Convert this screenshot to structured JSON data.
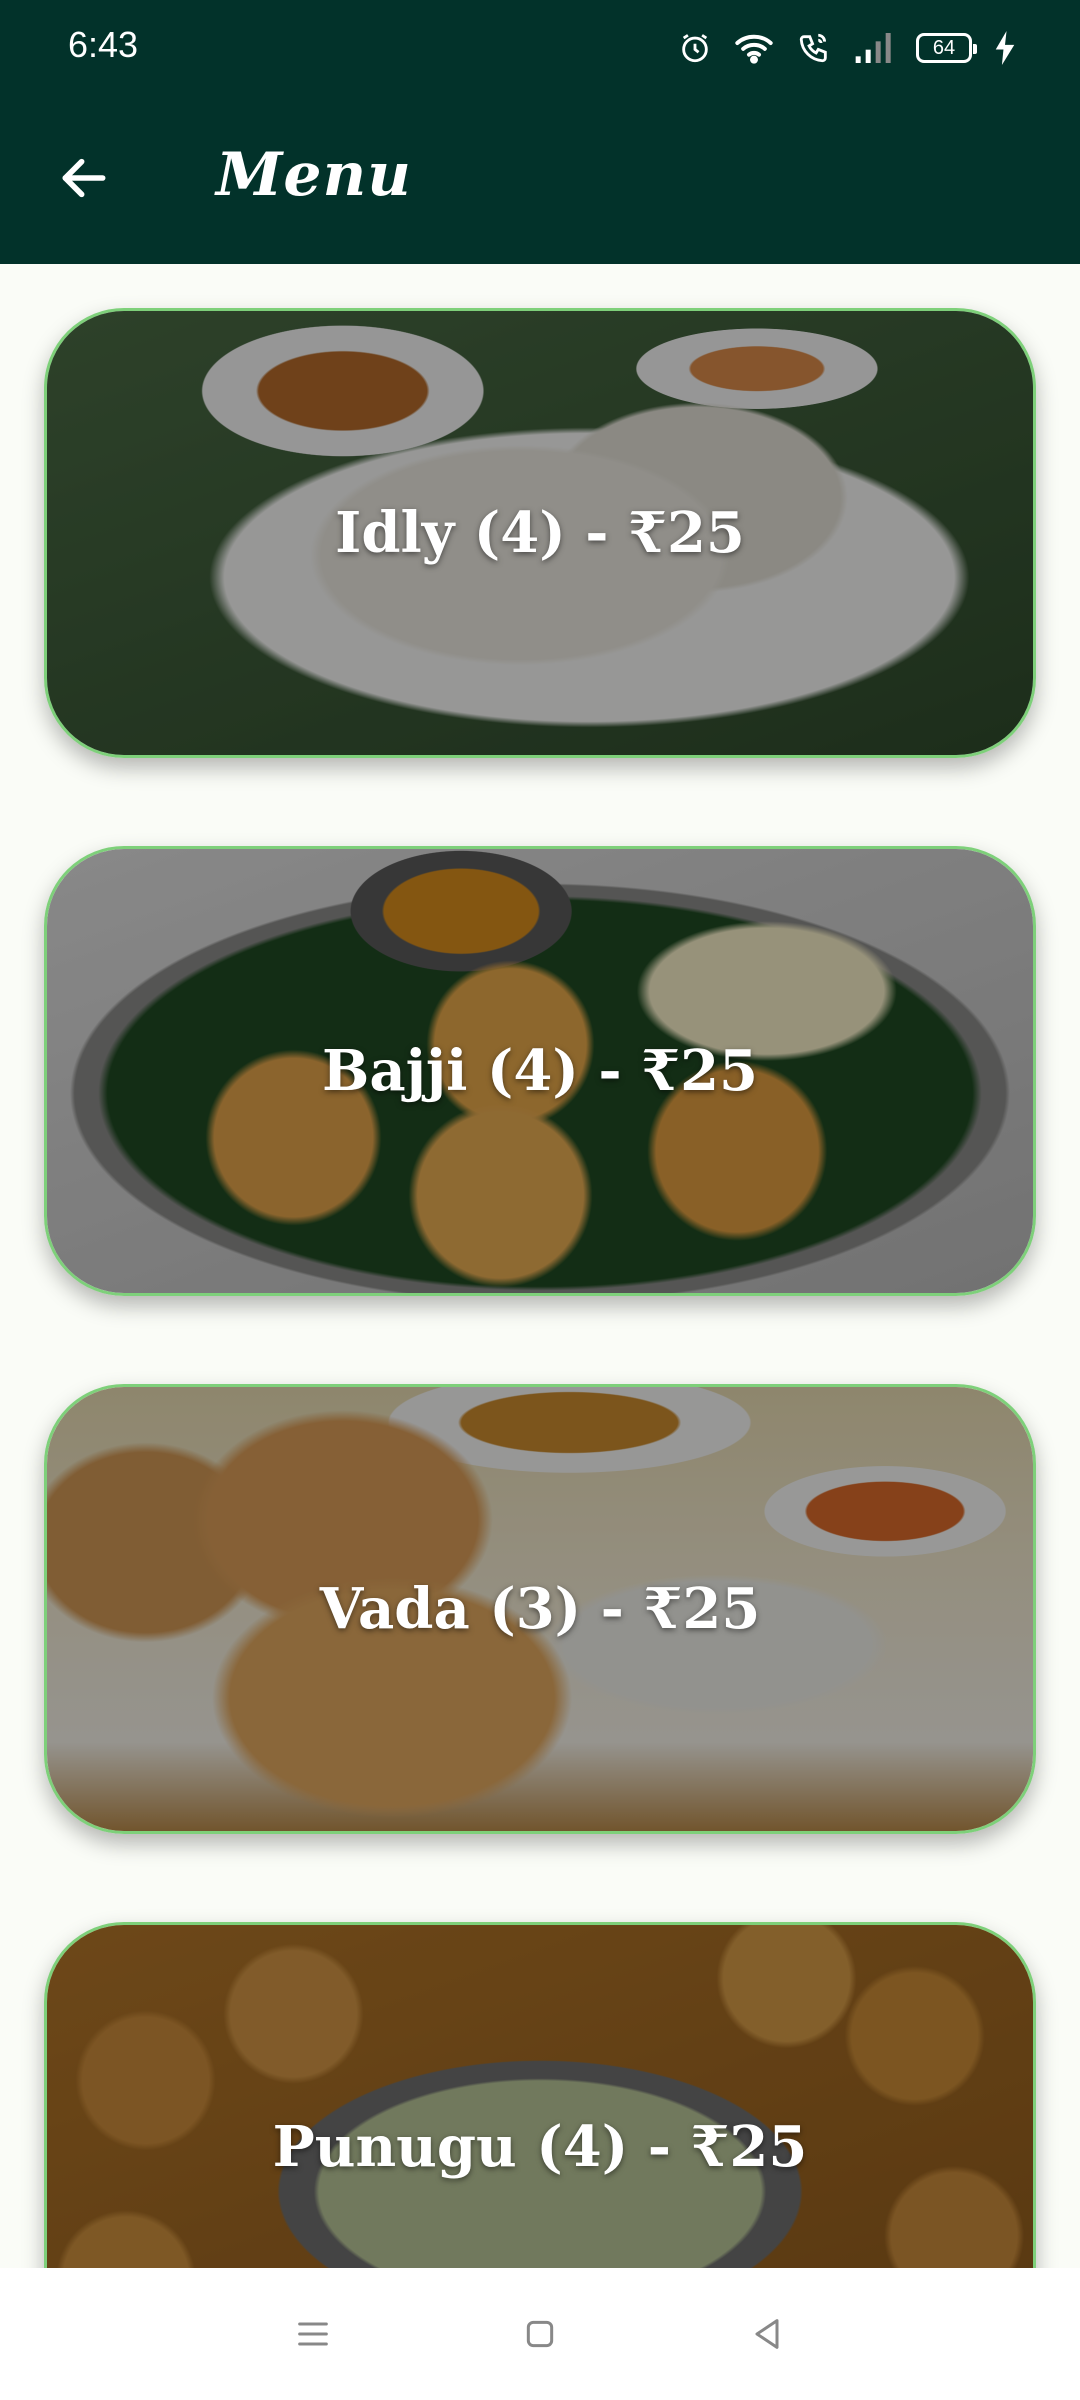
{
  "status_bar": {
    "time": "6:43",
    "battery": "64",
    "icons": [
      "alarm-icon",
      "wifi-icon",
      "wifi-call-icon",
      "signal-icon",
      "battery-icon",
      "charging-icon"
    ]
  },
  "app_bar": {
    "title": "Menu",
    "back_icon": "arrow-left-icon"
  },
  "menu": {
    "items": [
      {
        "label": "Idly (4) - ₹25"
      },
      {
        "label": "Bajji (4) - ₹25"
      },
      {
        "label": "Vada (3) - ₹25"
      },
      {
        "label": "Punugu (4) - ₹25"
      }
    ]
  },
  "nav_bar": {
    "icons": [
      "menu-icon",
      "home-icon",
      "back-icon"
    ]
  },
  "colors": {
    "header_bg": "#02322a",
    "card_border": "#7ed07a",
    "page_bg": "#fafcf7"
  }
}
